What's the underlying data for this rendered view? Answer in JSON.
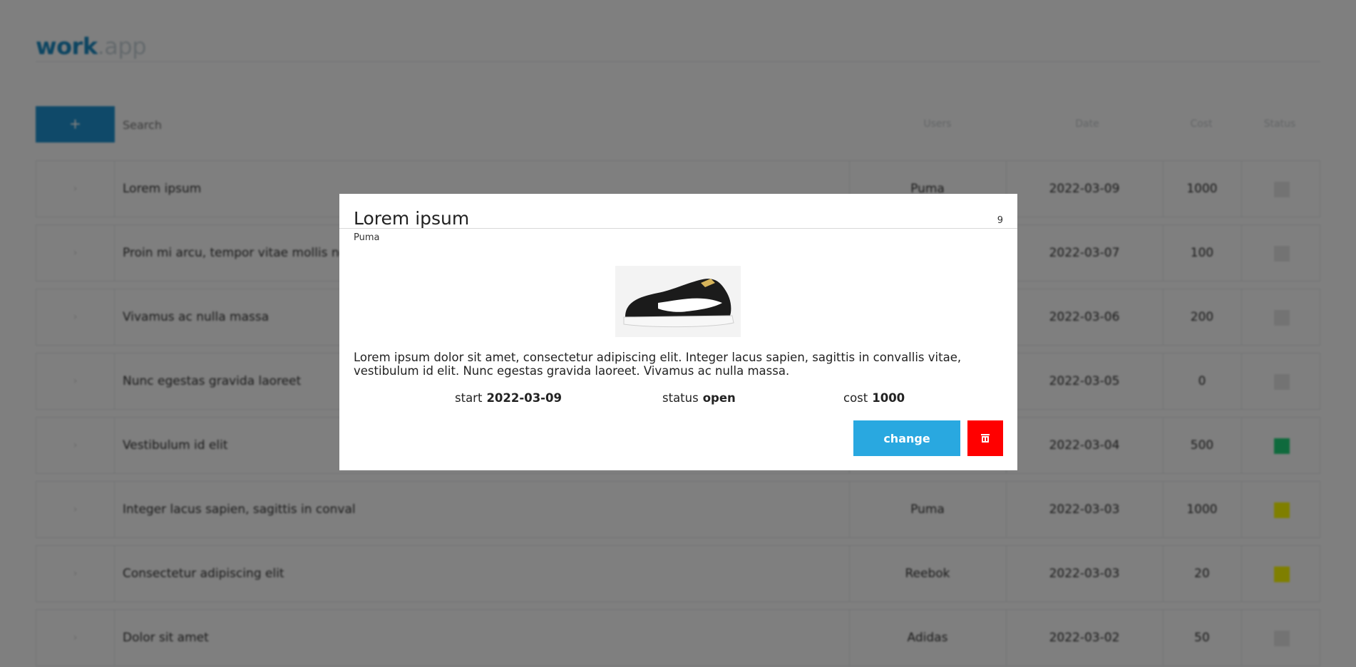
{
  "app": {
    "logo_bold": "work",
    "logo_light": ".app",
    "add_label": "+",
    "search_placeholder": "Search",
    "columns": [
      "Users",
      "Date",
      "Cost",
      "Status"
    ]
  },
  "rows": [
    {
      "title": "Lorem ipsum",
      "brand": "Puma",
      "date": "2022-03-09",
      "cost": "1000",
      "status_color": "#e6e6e6"
    },
    {
      "title": "Proin mi arcu, tempor vitae mollis nec",
      "brand": "",
      "date": "2022-03-07",
      "cost": "100",
      "status_color": "#e6e6e6"
    },
    {
      "title": "Vivamus ac nulla massa",
      "brand": "",
      "date": "2022-03-06",
      "cost": "200",
      "status_color": "#e6e6e6"
    },
    {
      "title": "Nunc egestas gravida laoreet",
      "brand": "",
      "date": "2022-03-05",
      "cost": "0",
      "status_color": "#e6e6e6"
    },
    {
      "title": "Vestibulum id elit",
      "brand": "",
      "date": "2022-03-04",
      "cost": "500",
      "status_color": "#1fd47a"
    },
    {
      "title": "Integer lacus sapien, sagittis in conval",
      "brand": "Puma",
      "date": "2022-03-03",
      "cost": "1000",
      "status_color": "#ffff00"
    },
    {
      "title": "Consectetur adipiscing elit",
      "brand": "Reebok",
      "date": "2022-03-03",
      "cost": "20",
      "status_color": "#ffff00"
    },
    {
      "title": "Dolor sit amet",
      "brand": "Adidas",
      "date": "2022-03-02",
      "cost": "50",
      "status_color": "#e6e6e6"
    }
  ],
  "modal": {
    "title": "Lorem ipsum",
    "id": "9",
    "brand": "Puma",
    "description": "Lorem ipsum dolor sit amet, consectetur adipiscing elit. Integer lacus sapien, sagittis in convallis vitae, vestibulum id elit. Nunc egestas gravida laoreet. Vivamus ac nulla massa.",
    "start_label": "start",
    "start_value": "2022-03-09",
    "status_label": "status",
    "status_value": "open",
    "cost_label": "cost",
    "cost_value": "1000",
    "change_label": "change",
    "delete_icon": "trash-icon",
    "colors": {
      "change": "#29a8e0",
      "delete": "#ff0000"
    }
  }
}
